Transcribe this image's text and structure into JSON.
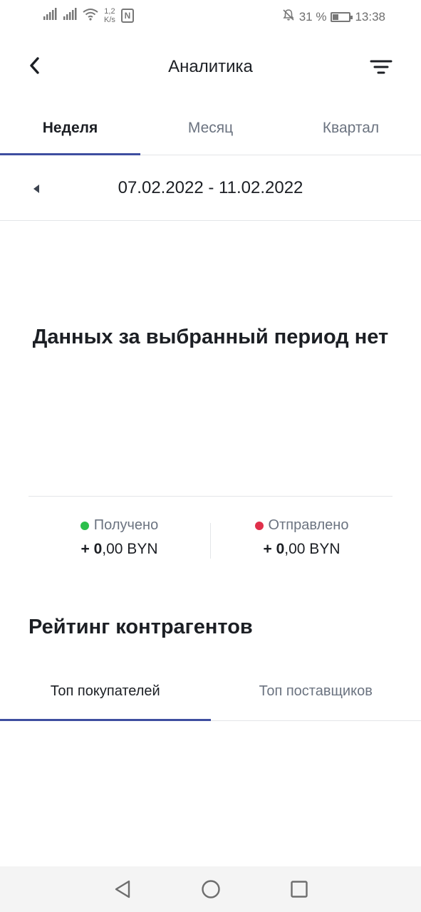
{
  "statusbar": {
    "netspeed_value": "1,2",
    "netspeed_unit": "K/s",
    "nfc_label": "N",
    "battery_text": "31 %",
    "battery_level": 0.31,
    "time": "13:38"
  },
  "header": {
    "title": "Аналитика"
  },
  "period_tabs": [
    {
      "label": "Неделя",
      "active": true
    },
    {
      "label": "Месяц",
      "active": false
    },
    {
      "label": "Квартал",
      "active": false
    }
  ],
  "date_range": "07.02.2022 - 11.02.2022",
  "empty_message": "Данных за выбранный период нет",
  "totals": {
    "received": {
      "label": "Получено",
      "sign": "+",
      "amount_int": "0",
      "amount_rest": ",00 BYN",
      "color": "#2bbf4b"
    },
    "sent": {
      "label": "Отправлено",
      "sign": "+",
      "amount_int": "0",
      "amount_rest": ",00 BYN",
      "color": "#e0304b"
    }
  },
  "rating": {
    "title": "Рейтинг контрагентов",
    "tabs": [
      {
        "label": "Топ покупателей",
        "active": true
      },
      {
        "label": "Топ поставщиков",
        "active": false
      }
    ]
  },
  "colors": {
    "accent": "#3e4ea0",
    "text": "#1c1f24",
    "muted": "#6b7380"
  }
}
